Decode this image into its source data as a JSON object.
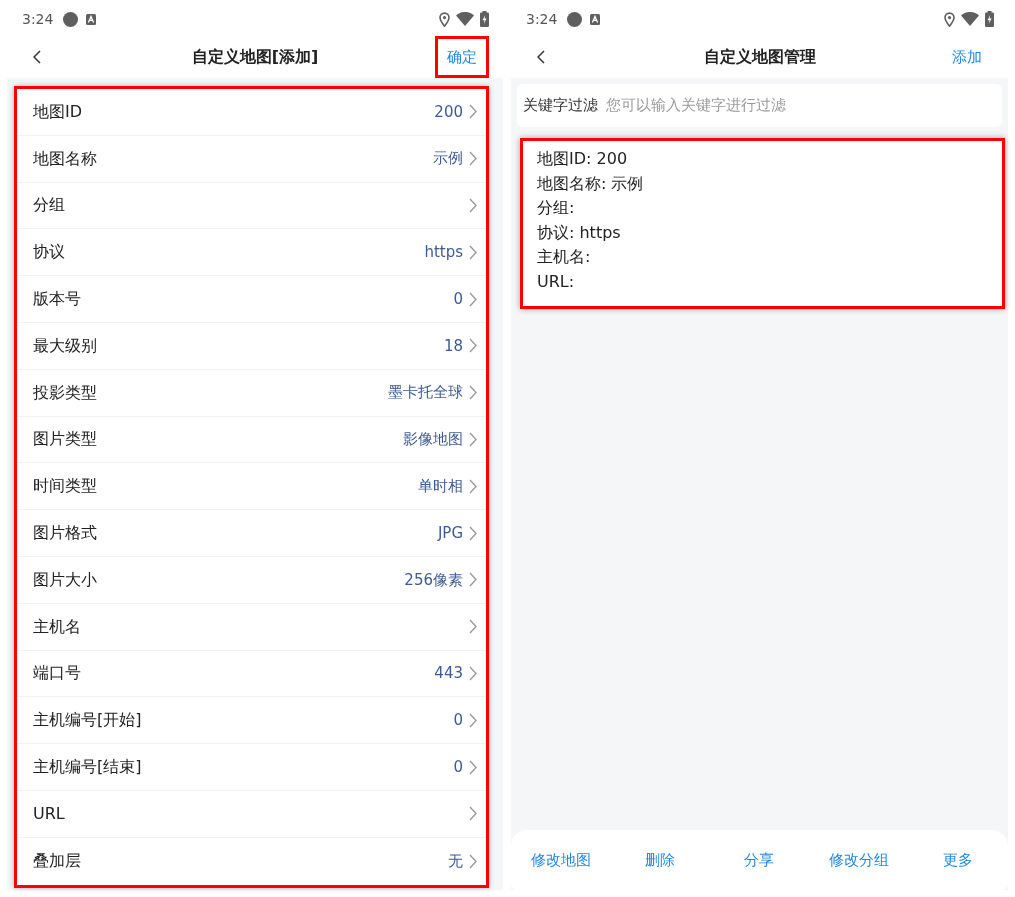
{
  "add_map_screen": {
    "status_bar": {
      "time": "3:24"
    },
    "header": {
      "title": "自定义地图[添加]",
      "action": "确定",
      "action_highlighted": true
    },
    "form": {
      "highlighted": true,
      "fields": [
        {
          "label": "地图ID",
          "value": "200"
        },
        {
          "label": "地图名称",
          "value": "示例"
        },
        {
          "label": "分组"
        },
        {
          "label": "协议",
          "value": "https"
        },
        {
          "label": "版本号",
          "value": "0"
        },
        {
          "label": "最大级别",
          "value": "18"
        },
        {
          "label": "投影类型",
          "value": "墨卡托全球"
        },
        {
          "label": "图片类型",
          "value": "影像地图"
        },
        {
          "label": "时间类型",
          "value": "单时相"
        },
        {
          "label": "图片格式",
          "value": "JPG"
        },
        {
          "label": "图片大小",
          "value": "256像素"
        },
        {
          "label": "主机名"
        },
        {
          "label": "端口号",
          "value": "443"
        },
        {
          "label": "主机编号[开始]",
          "value": "0"
        },
        {
          "label": "主机编号[结束]",
          "value": "0"
        },
        {
          "label": "URL"
        },
        {
          "label": "叠加层",
          "value": "无"
        }
      ]
    }
  },
  "map_manager_screen": {
    "status_bar": {
      "time": "3:24"
    },
    "header": {
      "title": "自定义地图管理",
      "action": "添加",
      "action_highlighted": false
    },
    "filter": {
      "label": "关键字过滤",
      "placeholder": "您可以输入关键字进行过滤"
    },
    "maps": [
      {
        "highlighted": true,
        "lines": [
          "地图ID: 200",
          "地图名称: 示例",
          "分组:",
          "协议: https",
          "主机名:",
          "URL:"
        ]
      }
    ],
    "actions": [
      "修改地图",
      "删除",
      "分享",
      "修改分组",
      "更多"
    ]
  }
}
